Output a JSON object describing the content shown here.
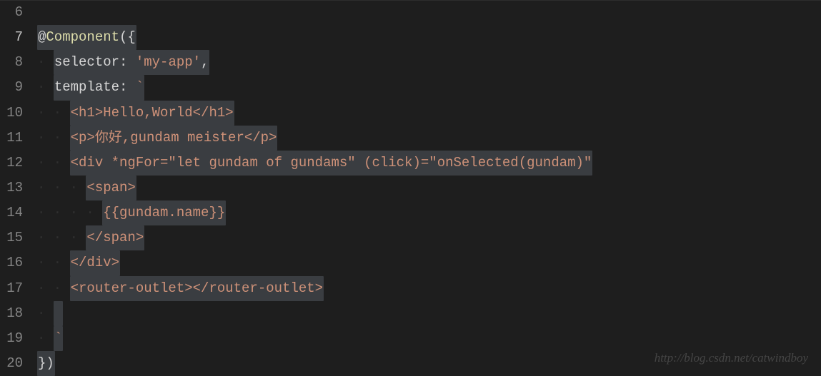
{
  "lineStart": 6,
  "activeLine": 7,
  "lines": {
    "l6": "",
    "l7": {
      "at": "@",
      "fn": "Component",
      "open": "({",
      "close": ""
    },
    "l8": {
      "indent": "  ",
      "key": "selector",
      "colon": ": ",
      "str": "'my-app'",
      "comma": ","
    },
    "l9": {
      "indent": "  ",
      "key": "template",
      "colon": ": ",
      "tick": "`"
    },
    "l10": {
      "indent": "    ",
      "text": "<h1>Hello,World</h1>"
    },
    "l11": {
      "indent": "    ",
      "text": "<p>你好,gundam meister</p>"
    },
    "l12": {
      "indent": "    ",
      "text": "<div *ngFor=\"let gundam of gundams\" (click)=\"onSelected(gundam)\""
    },
    "l13": {
      "indent": "      ",
      "text": "<span>"
    },
    "l14": {
      "indent": "        ",
      "text": "{{gundam.name}}"
    },
    "l15": {
      "indent": "      ",
      "text": "</span>"
    },
    "l16": {
      "indent": "    ",
      "text": "</div>"
    },
    "l17": {
      "indent": "    ",
      "text": "<router-outlet></router-outlet>"
    },
    "l18": {
      "indent": "  ",
      "text": ""
    },
    "l19": {
      "indent": "  ",
      "tick": "`"
    },
    "l20": {
      "close": "})"
    }
  },
  "watermark": "http://blog.csdn.net/catwindboy"
}
